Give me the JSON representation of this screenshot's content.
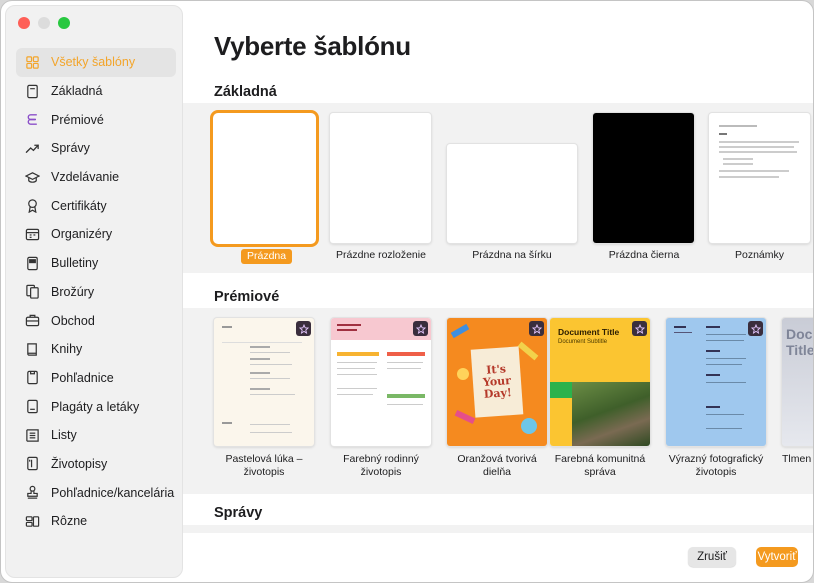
{
  "sidebar": {
    "items": [
      {
        "label": "Všetky šablóny",
        "icon": "grid-icon",
        "active": true
      },
      {
        "label": "Základná",
        "icon": "document-icon"
      },
      {
        "label": "Prémiové",
        "icon": "premium-icon"
      },
      {
        "label": "Správy",
        "icon": "trend-chart-icon"
      },
      {
        "label": "Vzdelávanie",
        "icon": "graduation-cap-icon"
      },
      {
        "label": "Certifikáty",
        "icon": "ribbon-icon"
      },
      {
        "label": "Organizéry",
        "icon": "calendar-icon"
      },
      {
        "label": "Bulletiny",
        "icon": "newsletter-icon"
      },
      {
        "label": "Brožúry",
        "icon": "brochure-icon"
      },
      {
        "label": "Obchod",
        "icon": "briefcase-icon"
      },
      {
        "label": "Knihy",
        "icon": "book-icon"
      },
      {
        "label": "Pohľadnice",
        "icon": "postcard-icon"
      },
      {
        "label": "Plagáty a letáky",
        "icon": "poster-icon"
      },
      {
        "label": "Listy",
        "icon": "letter-icon"
      },
      {
        "label": "Životopisy",
        "icon": "resume-icon"
      },
      {
        "label": "Pohľadnice/kancelária",
        "icon": "stamp-icon"
      },
      {
        "label": "Rôzne",
        "icon": "misc-icon"
      }
    ]
  },
  "main": {
    "title": "Vyberte šablónu",
    "sections": {
      "basic": "Základná",
      "premium": "Prémiové",
      "reports": "Správy"
    },
    "basic_templates": [
      {
        "label": "Prázdna"
      },
      {
        "label": "Prázdne rozloženie"
      },
      {
        "label": "Prázdna na šírku"
      },
      {
        "label": "Prázdna čierna"
      },
      {
        "label": "Poznámky"
      }
    ],
    "premium_templates": [
      {
        "label": "Pastelová lúka – životopis"
      },
      {
        "label": "Farebný rodinný životopis"
      },
      {
        "label": "Oranžová tvorivá dielňa"
      },
      {
        "label": "Farebná komunitná správa"
      },
      {
        "label": "Výrazný fotografický životopis"
      },
      {
        "label": "Tlmen"
      }
    ],
    "thumb_text": {
      "orange_day": "It's Your Day!",
      "document_title": "Document Title",
      "document_subtitle": "Document Subtitle",
      "partial_doc": "Docu Title"
    }
  },
  "footer": {
    "cancel": "Zrušiť",
    "create": "Vytvoriť"
  },
  "colors": {
    "accent": "#f49a1f",
    "traffic_close": "#fe5f57",
    "traffic_max": "#28c840"
  }
}
